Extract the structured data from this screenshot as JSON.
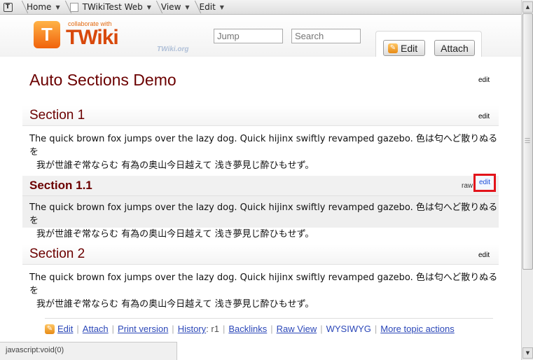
{
  "toolbar": {
    "logo_letter": "T",
    "crumbs": [
      {
        "label": "Home"
      },
      {
        "label": "TWikiTest Web"
      },
      {
        "label": "View"
      },
      {
        "label": "Edit"
      }
    ],
    "arrow": "▼"
  },
  "header": {
    "logo_letter": "T",
    "tagline": "collaborate with",
    "wordmark": "TWiki",
    "site": "TWiki.org",
    "jump_placeholder": "Jump",
    "search_placeholder": "Search",
    "edit_label": "Edit",
    "attach_label": "Attach"
  },
  "page": {
    "title": "Auto Sections Demo",
    "title_edit": "edit",
    "sections": [
      {
        "heading": "Section 1",
        "edit": "edit",
        "line1": "The quick brown fox jumps over the lazy dog. Quick hijinx swiftly revamped gazebo. 色は匂へど散りぬるを",
        "line2": "我が世誰ぞ常ならむ 有為の奥山今日越えて  浅き夢見じ酔ひもせず。"
      },
      {
        "heading": "Section 1.1",
        "raw": "raw",
        "edit": "edit",
        "line1": "The quick brown fox jumps over the lazy dog. Quick hijinx swiftly revamped gazebo. 色は匂へど散りぬるを",
        "line2": "我が世誰ぞ常ならむ 有為の奥山今日越えて  浅き夢見じ酔ひもせず。"
      },
      {
        "heading": "Section 2",
        "edit": "edit",
        "line1": "The quick brown fox jumps over the lazy dog. Quick hijinx swiftly revamped gazebo. 色は匂へど散りぬるを",
        "line2": "我が世誰ぞ常ならむ 有為の奥山今日越えて  浅き夢見じ酔ひもせず。"
      }
    ]
  },
  "actions": {
    "edit": "Edit",
    "attach": "Attach",
    "print": "Print version",
    "history": "History",
    "history_rev": ": r1",
    "backlinks": "Backlinks",
    "raw_view": "Raw View",
    "wysiwyg": "WYSIWYG",
    "more": "More topic actions"
  },
  "status": {
    "text": "javascript:void(0)"
  },
  "colors": {
    "heading": "#6b0000",
    "link": "#2b47b8",
    "highlight_border": "#e3141b",
    "logo_orange": "#f0620c"
  }
}
